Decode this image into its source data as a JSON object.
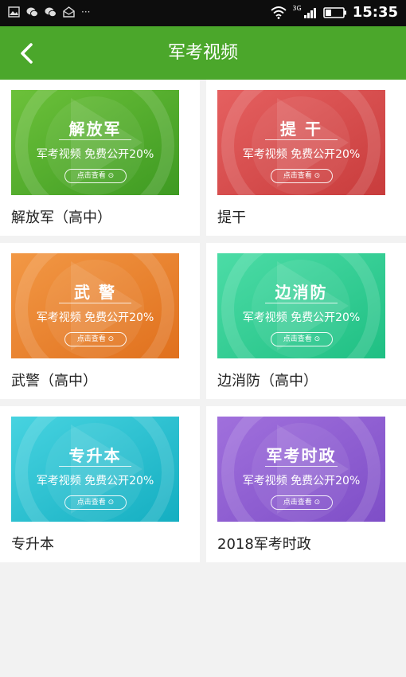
{
  "status_bar": {
    "time": "15:35",
    "overflow": "···",
    "network": "3G"
  },
  "header": {
    "title": "军考视频"
  },
  "cards": [
    {
      "title": "解放军",
      "subtitle": "军考视频  免费公开20%",
      "button": "点击查看",
      "label": "解放军（高中）",
      "color_a": "#6cc13a",
      "color_b": "#3e9a22"
    },
    {
      "title": "提 干",
      "subtitle": "军考视频  免费公开20%",
      "button": "点击查看",
      "label": "提干",
      "color_a": "#e56060",
      "color_b": "#c83c3c"
    },
    {
      "title": "武 警",
      "subtitle": "军考视频  免费公开20%",
      "button": "点击查看",
      "label": "武警（高中）",
      "color_a": "#f29845",
      "color_b": "#e0701d"
    },
    {
      "title": "边消防",
      "subtitle": "军考视频  免费公开20%",
      "button": "点击查看",
      "label": "边消防（高中）",
      "color_a": "#4cdca6",
      "color_b": "#1fbf83"
    },
    {
      "title": "专升本",
      "subtitle": "军考视频  免费公开20%",
      "button": "点击查看",
      "label": "专升本",
      "color_a": "#47d3e0",
      "color_b": "#14aec1"
    },
    {
      "title": "军考时政",
      "subtitle": "军考视频  免费公开20%",
      "button": "点击查看",
      "label": "2018军考时政",
      "color_a": "#a070dc",
      "color_b": "#7e4ec7"
    }
  ]
}
